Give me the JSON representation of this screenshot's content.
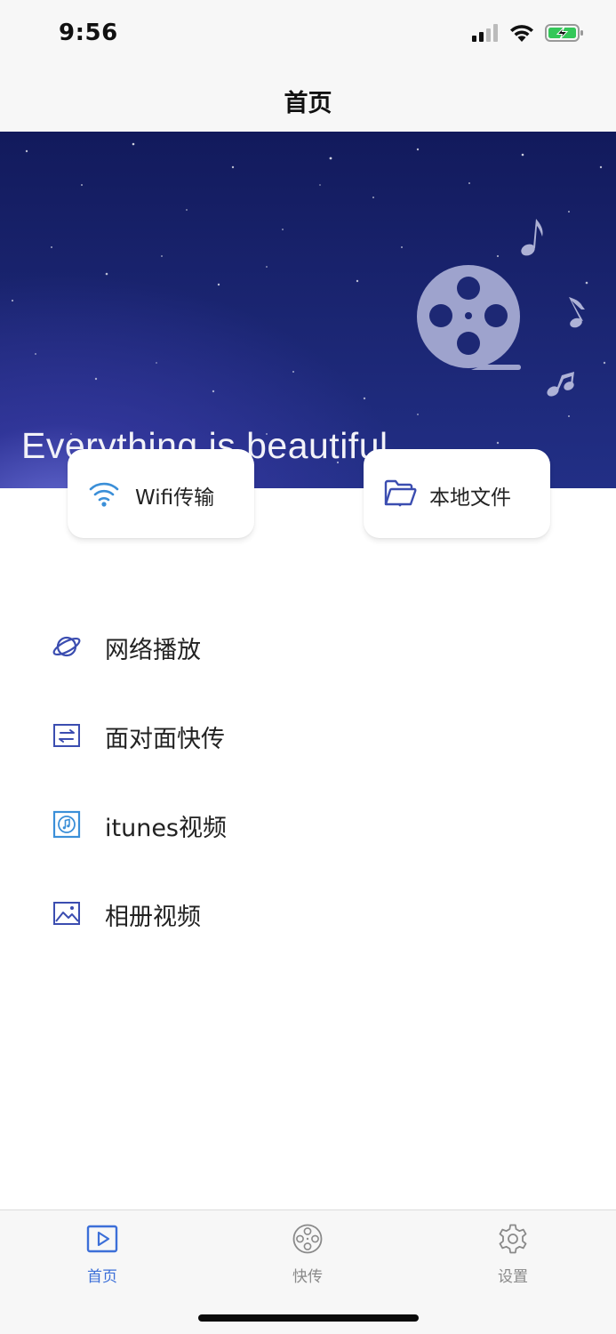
{
  "status_bar": {
    "time": "9:56"
  },
  "nav": {
    "title": "首页"
  },
  "banner": {
    "headline": "Everything is beautiful"
  },
  "quick_actions": [
    {
      "label": "Wifi传输",
      "icon": "wifi-icon"
    },
    {
      "label": "本地文件",
      "icon": "folder-icon"
    }
  ],
  "menu": [
    {
      "label": "网络播放",
      "icon": "planet-icon"
    },
    {
      "label": "面对面快传",
      "icon": "transfer-icon"
    },
    {
      "label": "itunes视频",
      "icon": "itunes-icon"
    },
    {
      "label": "相册视频",
      "icon": "photo-icon"
    }
  ],
  "tabs": [
    {
      "label": "首页",
      "icon": "play-icon",
      "active": true
    },
    {
      "label": "快传",
      "icon": "film-reel-icon",
      "active": false
    },
    {
      "label": "设置",
      "icon": "gear-icon",
      "active": false
    }
  ],
  "colors": {
    "accent": "#3c6fd8",
    "icon_blue": "#3b4db0",
    "banner_dark": "#121a5c"
  }
}
